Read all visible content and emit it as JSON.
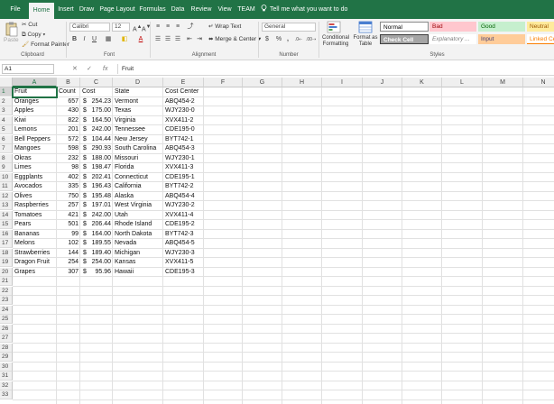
{
  "tabs": [
    {
      "label": "File",
      "active": false
    },
    {
      "label": "Home",
      "active": true
    },
    {
      "label": "Insert",
      "active": false
    },
    {
      "label": "Draw",
      "active": false
    },
    {
      "label": "Page Layout",
      "active": false
    },
    {
      "label": "Formulas",
      "active": false
    },
    {
      "label": "Data",
      "active": false
    },
    {
      "label": "Review",
      "active": false
    },
    {
      "label": "View",
      "active": false
    },
    {
      "label": "TEAM",
      "active": false
    }
  ],
  "tell_me": "Tell me what you want to do",
  "ribbon": {
    "clipboard": {
      "cut": "Cut",
      "copy": "Copy",
      "format_painter": "Format Painter",
      "paste": "Paste",
      "group": "Clipboard"
    },
    "font": {
      "name": "Calibri",
      "size": "12",
      "group": "Font",
      "bold": "B",
      "italic": "I",
      "underline": "U"
    },
    "alignment": {
      "wrap": "Wrap Text",
      "merge": "Merge & Center",
      "group": "Alignment"
    },
    "number": {
      "format": "General",
      "currency": "$",
      "percent": "%",
      "comma": ",",
      "group": "Number"
    },
    "styles": {
      "conditional": "Conditional Formatting",
      "format_as_table": "Format as Table",
      "group": "Styles",
      "cells": [
        {
          "label": "Normal",
          "bg": "#ffffff",
          "fg": "#000000"
        },
        {
          "label": "Bad",
          "bg": "#ffc7ce",
          "fg": "#9c0006"
        },
        {
          "label": "Good",
          "bg": "#c6efce",
          "fg": "#006100"
        },
        {
          "label": "Neutral",
          "bg": "#ffeb9c",
          "fg": "#9c5700"
        },
        {
          "label": "Check Cell",
          "bg": "#a5a5a5",
          "fg": "#ffffff"
        },
        {
          "label": "Explanatory ...",
          "bg": "#ffffff",
          "fg": "#7f7f7f"
        },
        {
          "label": "Input",
          "bg": "#ffcc99",
          "fg": "#3f3f76"
        },
        {
          "label": "Linked Ce",
          "bg": "#ffffff",
          "fg": "#fa7d00"
        }
      ]
    }
  },
  "formula_bar": {
    "name_box": "A1",
    "fx": "fx",
    "cancel": "✕",
    "enter": "✓",
    "content": "Fruit"
  },
  "columns": [
    "A",
    "B",
    "C",
    "D",
    "E",
    "F",
    "G",
    "H",
    "I",
    "J",
    "K",
    "L",
    "M",
    "N"
  ],
  "selected_column": "A",
  "selected_row": "1",
  "rows": [
    [
      "Fruit",
      "Count",
      "Cost",
      "State",
      "Cost Center"
    ],
    [
      "Oranges",
      "657",
      "254.23",
      "Vermont",
      "ABQ454-2"
    ],
    [
      "Apples",
      "430",
      "175.00",
      "Texas",
      "WJY230-0"
    ],
    [
      "Kiwi",
      "822",
      "164.50",
      "Virginia",
      "XVX411-2"
    ],
    [
      "Lemons",
      "201",
      "242.00",
      "Tennessee",
      "CDE195-0"
    ],
    [
      "Bell Peppers",
      "572",
      "104.44",
      "New Jersey",
      "BYT742-1"
    ],
    [
      "Mangoes",
      "598",
      "290.93",
      "South Carolina",
      "ABQ454-3"
    ],
    [
      "Okras",
      "232",
      "188.00",
      "Missouri",
      "WJY230-1"
    ],
    [
      "Limes",
      "98",
      "198.47",
      "Florida",
      "XVX411-3"
    ],
    [
      "Eggplants",
      "402",
      "202.41",
      "Connecticut",
      "CDE195-1"
    ],
    [
      "Avocados",
      "335",
      "196.43",
      "California",
      "BYT742-2"
    ],
    [
      "Olives",
      "750",
      "195.48",
      "Alaska",
      "ABQ454-4"
    ],
    [
      "Raspberries",
      "257",
      "197.01",
      "West Virginia",
      "WJY230-2"
    ],
    [
      "Tomatoes",
      "421",
      "242.00",
      "Utah",
      "XVX411-4"
    ],
    [
      "Pears",
      "501",
      "206.44",
      "Rhode Island",
      "CDE195-2"
    ],
    [
      "Bananas",
      "99",
      "164.00",
      "North Dakota",
      "BYT742-3"
    ],
    [
      "Melons",
      "102",
      "189.55",
      "Nevada",
      "ABQ454-5"
    ],
    [
      "Strawberries",
      "144",
      "189.40",
      "Michigan",
      "WJY230-3"
    ],
    [
      "Dragon Fruit",
      "254",
      "254.00",
      "Kansas",
      "XVX411-5"
    ],
    [
      "Grapes",
      "307",
      "95.96",
      "Hawaii",
      "CDE195-3"
    ]
  ],
  "currency_symbol": "$",
  "row_count": 33
}
